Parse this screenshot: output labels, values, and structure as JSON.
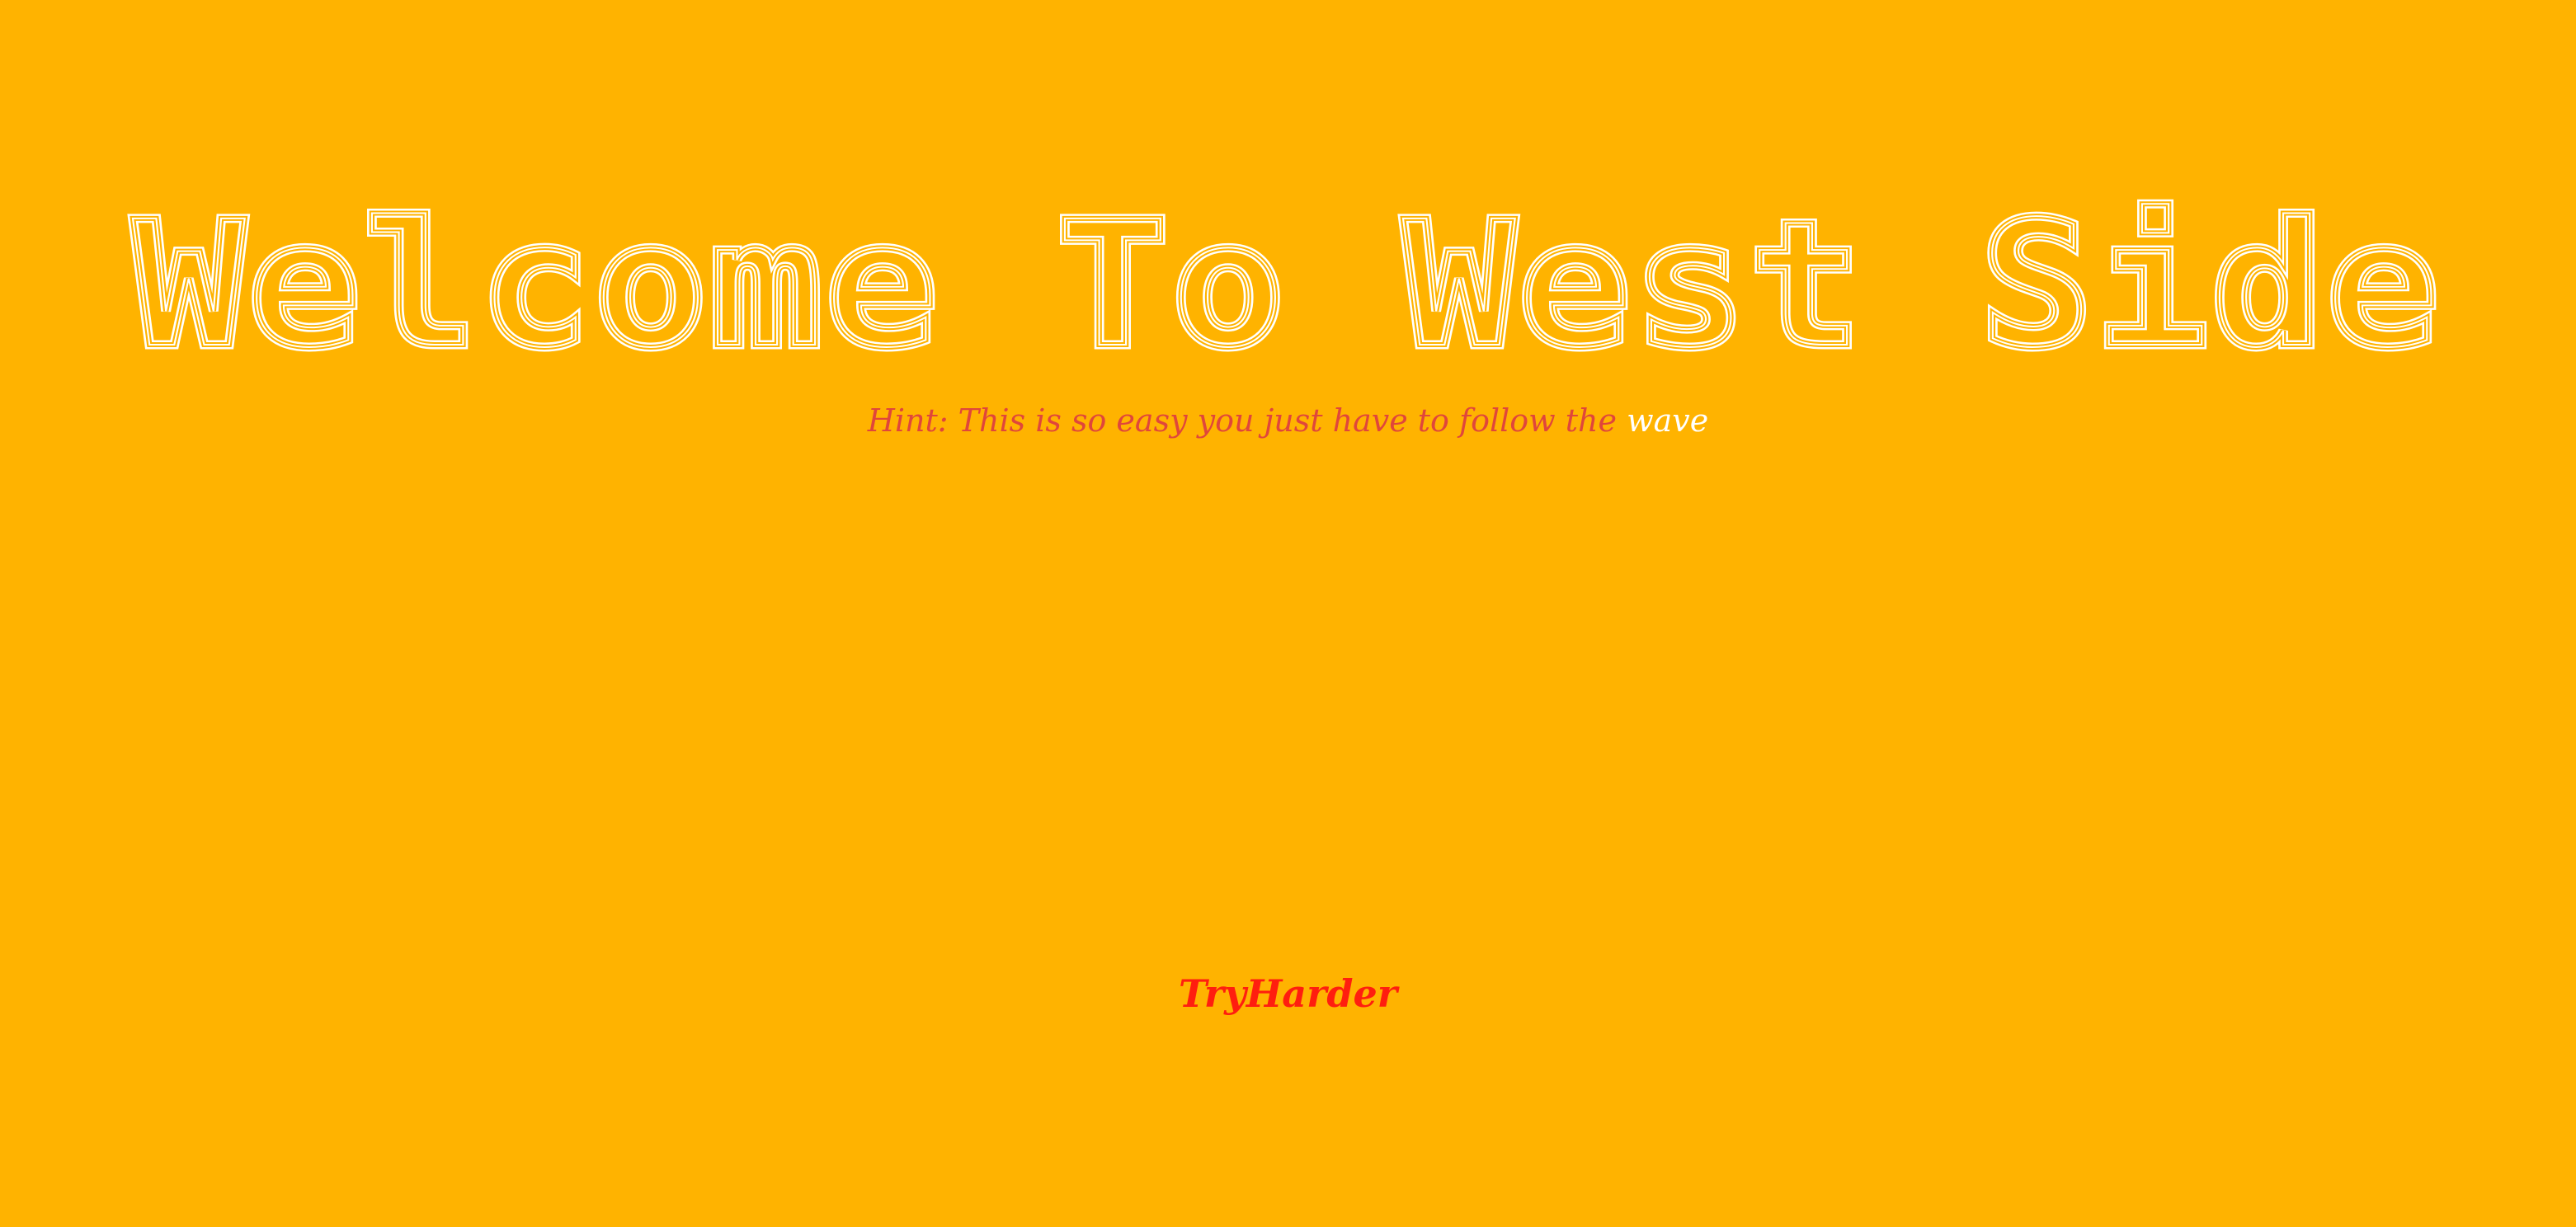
{
  "heading": {
    "text": "Welcome To West Side"
  },
  "hint": {
    "prefix": "Hint: This is so easy you just have to follow the",
    "highlight": "wave"
  },
  "link": {
    "label": "TryHarder"
  },
  "colors": {
    "background": "#FFB300",
    "heading": "#FFFFFF",
    "hint": "#E0463B",
    "hint_highlight": "#FFFFFF",
    "link": "#FF1E0F"
  }
}
